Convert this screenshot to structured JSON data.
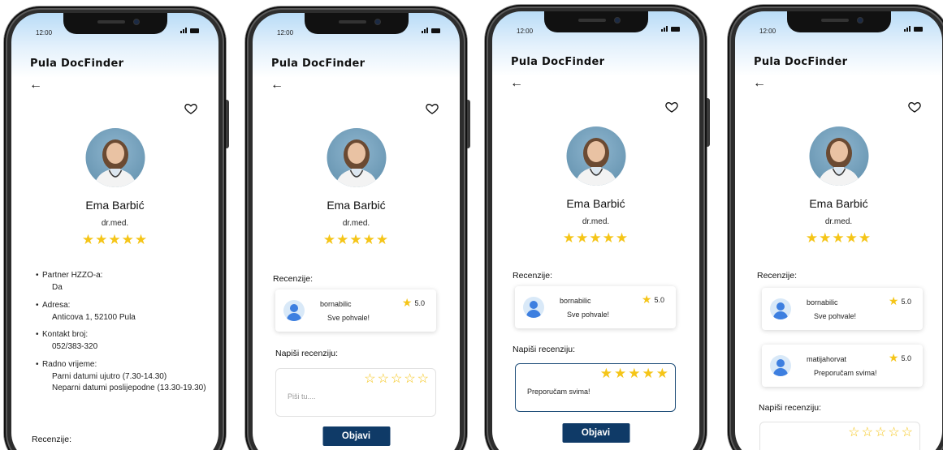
{
  "app": {
    "status_time": "12:00",
    "title": "Pula DocFinder",
    "back_icon": "arrow-left-icon",
    "favorite_icon": "heart-outline-icon"
  },
  "doctor": {
    "name": "Ema Barbić",
    "degree": "dr.med.",
    "stars": "★★★★★"
  },
  "info": {
    "partner_label": "Partner HZZO-a:",
    "partner_value": "Da",
    "address_label": "Adresa:",
    "address_value": "Anticova 1, 52100 Pula",
    "contact_label": "Kontakt broj:",
    "contact_value": "052/383-320",
    "hours_label": "Radno vrijeme:",
    "hours_even": "Parni datumi ujutro (7.30-14.30)",
    "hours_odd": "Neparni datumi poslijepodne (13.30-19.30)"
  },
  "reviews": {
    "section_label": "Recenzije:",
    "items": [
      {
        "user": "bornabilic",
        "text": "Sve pohvale!",
        "rating": "5.0"
      },
      {
        "user": "matijahorvat",
        "text": "Preporučam svima!",
        "rating": "5.0"
      }
    ]
  },
  "write_review": {
    "label": "Napiši recenziju:",
    "placeholder": "Piši tu....",
    "typed_value": "Preporučam svima!",
    "empty_stars": "☆☆☆☆☆",
    "full_stars": "★★★★★",
    "publish_label": "Objavi"
  },
  "colors": {
    "accent_star": "#f5c518",
    "button_bg": "#0f3a67",
    "header_gradient_top": "#b9dcf7"
  }
}
